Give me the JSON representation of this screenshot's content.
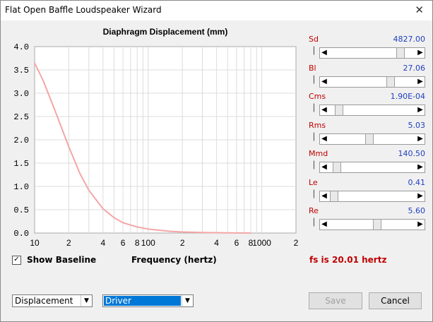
{
  "window": {
    "title": "Flat Open Baffle Loudspeaker Wizard",
    "close_glyph": "✕"
  },
  "chart_data": {
    "type": "line",
    "title": "Diaphragm Displacement (mm)",
    "xlabel": "Frequency (hertz)",
    "ylabel": "",
    "x_scale": "log",
    "xlim": [
      10,
      2000
    ],
    "ylim": [
      0,
      4.0
    ],
    "y_ticks": [
      "0.0",
      "0.5",
      "1.0",
      "1.5",
      "2.0",
      "2.5",
      "3.0",
      "3.5",
      "4.0"
    ],
    "x_tick_labels": [
      {
        "x": 10,
        "label": "10"
      },
      {
        "x": 20,
        "label": "2"
      },
      {
        "x": 40,
        "label": "4"
      },
      {
        "x": 60,
        "label": "6"
      },
      {
        "x": 80,
        "label": "8"
      },
      {
        "x": 100,
        "label": "100"
      },
      {
        "x": 200,
        "label": "2"
      },
      {
        "x": 400,
        "label": "4"
      },
      {
        "x": 600,
        "label": "6"
      },
      {
        "x": 800,
        "label": "8"
      },
      {
        "x": 1000,
        "label": "1000"
      },
      {
        "x": 2000,
        "label": "2"
      }
    ],
    "grid": true,
    "series": [
      {
        "color": "#f4a6a6",
        "x": [
          10,
          12,
          15,
          20,
          25,
          30,
          40,
          50,
          60,
          80,
          100,
          150,
          200,
          300,
          500,
          800
        ],
        "y": [
          3.65,
          3.25,
          2.65,
          1.85,
          1.28,
          0.92,
          0.52,
          0.33,
          0.22,
          0.13,
          0.085,
          0.04,
          0.022,
          0.01,
          0.004,
          0.0
        ]
      }
    ]
  },
  "sliders": [
    {
      "label": "Sd",
      "value": "4827.00",
      "position": 0.84
    },
    {
      "label": "Bl",
      "value": "27.06",
      "position": 0.72
    },
    {
      "label": "Cms",
      "value": "1.90E-04",
      "position": 0.08
    },
    {
      "label": "Rms",
      "value": "5.03",
      "position": 0.46
    },
    {
      "label": "Mmd",
      "value": "140.50",
      "position": 0.05
    },
    {
      "label": "Le",
      "value": "0.41",
      "position": 0.02
    },
    {
      "label": "Re",
      "value": "5.60",
      "position": 0.55
    }
  ],
  "controls": {
    "show_baseline_label": "Show Baseline",
    "show_baseline_checked": true,
    "frequency_label": "Frequency (hertz)",
    "fs_text": "fs is 20.01 hertz",
    "plot_select": "Displacement",
    "source_select": "Driver",
    "save_label": "Save",
    "cancel_label": "Cancel",
    "check_glyph": "✓",
    "dropdown_glyph": "▼",
    "left_arrow": "◀",
    "right_arrow": "▶"
  }
}
